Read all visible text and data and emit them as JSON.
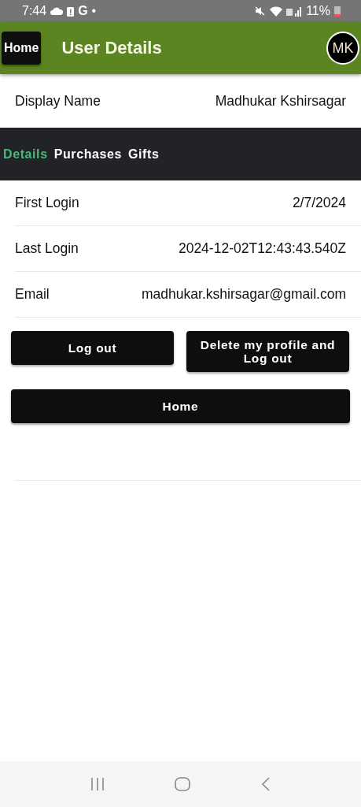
{
  "status_bar": {
    "time": "7:44",
    "carrier_letter": "G",
    "dot": "•",
    "battery": "11%"
  },
  "header": {
    "home_button": "Home",
    "title": "User Details",
    "avatar": "MK"
  },
  "display_name": {
    "label": "Display Name",
    "value": "Madhukar Kshirsagar"
  },
  "tabs": [
    {
      "label": "Details",
      "selected": true
    },
    {
      "label": "Purchases",
      "selected": false
    },
    {
      "label": "Gifts",
      "selected": false
    }
  ],
  "details": [
    {
      "label": "First Login",
      "value": "2/7/2024"
    },
    {
      "label": "Last Login",
      "value": "2024-12-02T12:43:43.540Z"
    },
    {
      "label": "Email",
      "value": "madhukar.kshirsagar@gmail.com"
    }
  ],
  "buttons": {
    "logout": "Log out",
    "delete": "Delete my profile and Log out",
    "home": "Home"
  }
}
